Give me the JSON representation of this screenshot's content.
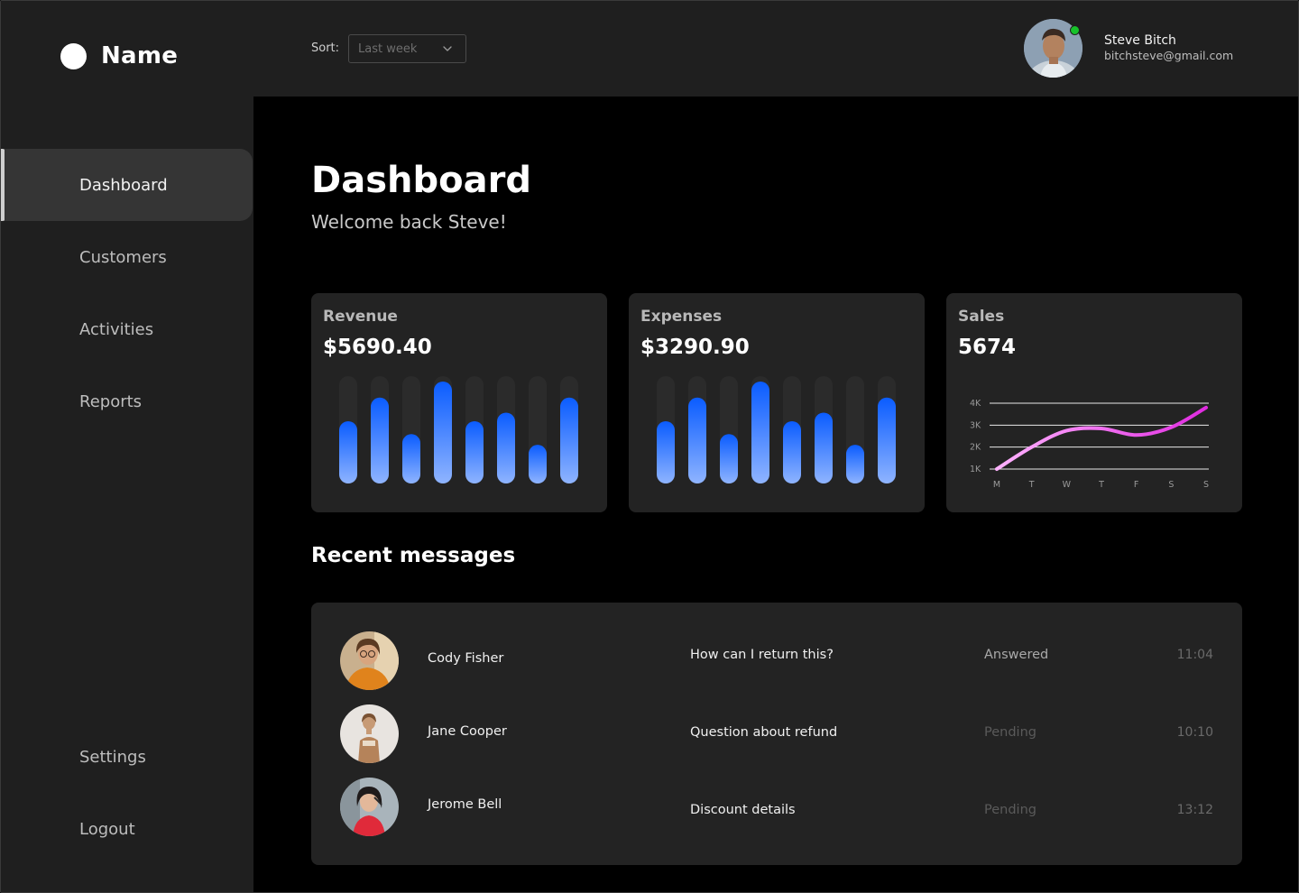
{
  "brand": {
    "name": "Name"
  },
  "sidebar": {
    "items": [
      {
        "label": "Dashboard",
        "active": true
      },
      {
        "label": "Customers"
      },
      {
        "label": "Activities"
      },
      {
        "label": "Reports"
      }
    ],
    "bottom": [
      {
        "label": "Settings"
      },
      {
        "label": "Logout"
      }
    ]
  },
  "header": {
    "sort_label": "Sort:",
    "sort_value": "Last week",
    "user": {
      "name": "Steve Bitch",
      "email": "bitchsteve@gmail.com",
      "online": true
    }
  },
  "page": {
    "title": "Dashboard",
    "subtitle": "Welcome back Steve!"
  },
  "cards": {
    "revenue": {
      "label": "Revenue",
      "value": "$5690.40"
    },
    "expenses": {
      "label": "Expenses",
      "value": "$3290.90"
    },
    "sales": {
      "label": "Sales",
      "value": "5674"
    }
  },
  "chart_data": [
    {
      "type": "bar",
      "categories": [
        "1",
        "2",
        "3",
        "4",
        "5",
        "6",
        "7",
        "8"
      ],
      "values": [
        0.58,
        0.8,
        0.46,
        0.95,
        0.58,
        0.66,
        0.36,
        0.8
      ],
      "ylim": [
        0,
        1
      ],
      "grid": false
    },
    {
      "type": "bar",
      "categories": [
        "1",
        "2",
        "3",
        "4",
        "5",
        "6",
        "7",
        "8"
      ],
      "values": [
        0.58,
        0.8,
        0.46,
        0.95,
        0.58,
        0.66,
        0.36,
        0.8
      ],
      "ylim": [
        0,
        1
      ],
      "grid": false
    },
    {
      "type": "line",
      "x": [
        "M",
        "T",
        "W",
        "T",
        "F",
        "S",
        "S"
      ],
      "y": [
        1000,
        2000,
        2750,
        2850,
        2550,
        2900,
        3800
      ],
      "yticks": [
        "1K",
        "2K",
        "3K",
        "4K"
      ],
      "ylim": [
        1000,
        4000
      ],
      "grid": true
    }
  ],
  "messages": {
    "title": "Recent messages",
    "rows": [
      {
        "name": "Cody Fisher",
        "subject": "How can I return this?",
        "status": "Answered",
        "time": "11:04"
      },
      {
        "name": "Jane Cooper",
        "subject": "Question about refund",
        "status": "Pending",
        "time": "10:10"
      },
      {
        "name": "Jerome Bell",
        "subject": "Discount details",
        "status": "Pending",
        "time": "13:12"
      }
    ]
  },
  "colors": {
    "bar_top": "#0a5cff",
    "bar_bottom": "#8fb4ff",
    "line_start": "#ffb3ff",
    "line_end": "#e02be0",
    "status_answered": "#a9a9a9",
    "status_pending": "#5a5a5a",
    "online": "#17c22a"
  },
  "icons": {
    "sort_chevron": "chevron-down-icon",
    "logo": "circle-logo-icon"
  }
}
